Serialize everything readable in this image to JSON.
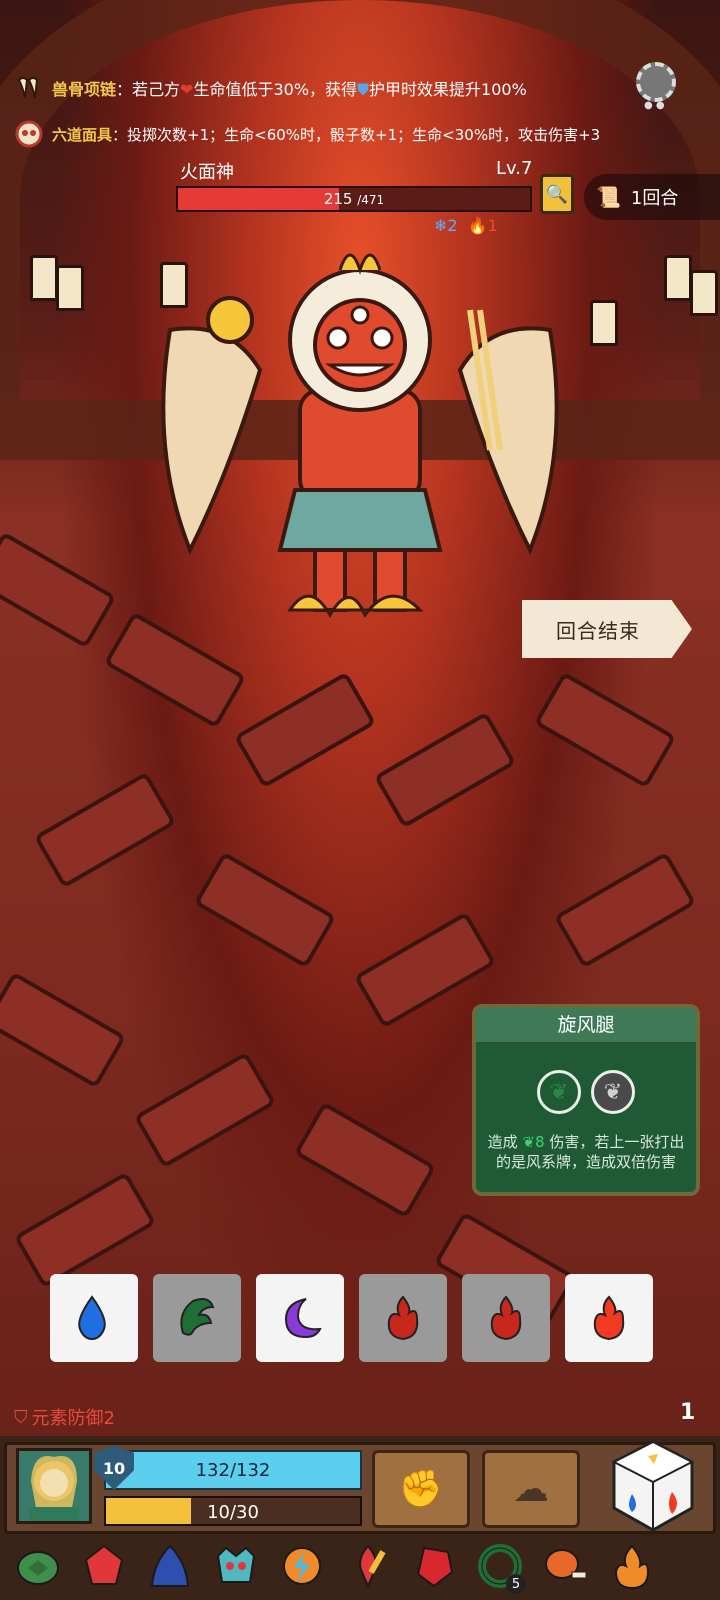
{
  "relics_info": [
    {
      "icon": "claw-necklace-icon",
      "name": "兽骨项链",
      "sep": "：",
      "text_a": "若己方",
      "text_b": "生命值低于30%，获得",
      "text_c": "护甲时效果提升100%"
    },
    {
      "icon": "mask-icon",
      "name": "六道面具",
      "sep": "：",
      "text_a": "投掷次数+1；生命<60%时，骰子数+1；生命<30%时，攻击伤害+3"
    }
  ],
  "enemy": {
    "name": "火面神",
    "level": "Lv.7",
    "hp": 215,
    "hp_max": "/471",
    "hp_fraction": 0.456,
    "status_frost": "2",
    "status_fire": "1"
  },
  "round": {
    "label": "1回合"
  },
  "end_turn_button": "回合结束",
  "card": {
    "title": "旋风腿",
    "desc_prefix": "造成",
    "damage": "8",
    "desc_suffix": "伤害，若上一张打出的是风系牌，造成双倍伤害"
  },
  "dice": [
    {
      "element": "water",
      "color": "#1f6fe0",
      "state": "active"
    },
    {
      "element": "wind",
      "color": "#1f6e34",
      "state": "used"
    },
    {
      "element": "moon",
      "color": "#8a3ad9",
      "state": "active"
    },
    {
      "element": "fire",
      "color": "#c8281c",
      "state": "used"
    },
    {
      "element": "fire",
      "color": "#c8281c",
      "state": "used"
    },
    {
      "element": "fire",
      "color": "#f03a22",
      "state": "active"
    }
  ],
  "element_defense": "元素防御2",
  "dice_count": "1",
  "player": {
    "shield": "10",
    "hp_text": "132/132",
    "exp_text": "10/30",
    "exp_fraction": 0.333
  },
  "relic_bar": [
    {
      "icon": "turtle-shell-icon",
      "badge": ""
    },
    {
      "icon": "red-gem-icon",
      "badge": ""
    },
    {
      "icon": "blue-cloak-icon",
      "badge": ""
    },
    {
      "icon": "crown-mask-icon",
      "badge": ""
    },
    {
      "icon": "lightning-orb-icon",
      "badge": ""
    },
    {
      "icon": "fire-dagger-icon",
      "badge": ""
    },
    {
      "icon": "ruby-icon",
      "badge": ""
    },
    {
      "icon": "green-ring-icon",
      "badge": "5"
    },
    {
      "icon": "meat-leg-icon",
      "badge": ""
    },
    {
      "icon": "flame-icon",
      "badge": ""
    }
  ]
}
